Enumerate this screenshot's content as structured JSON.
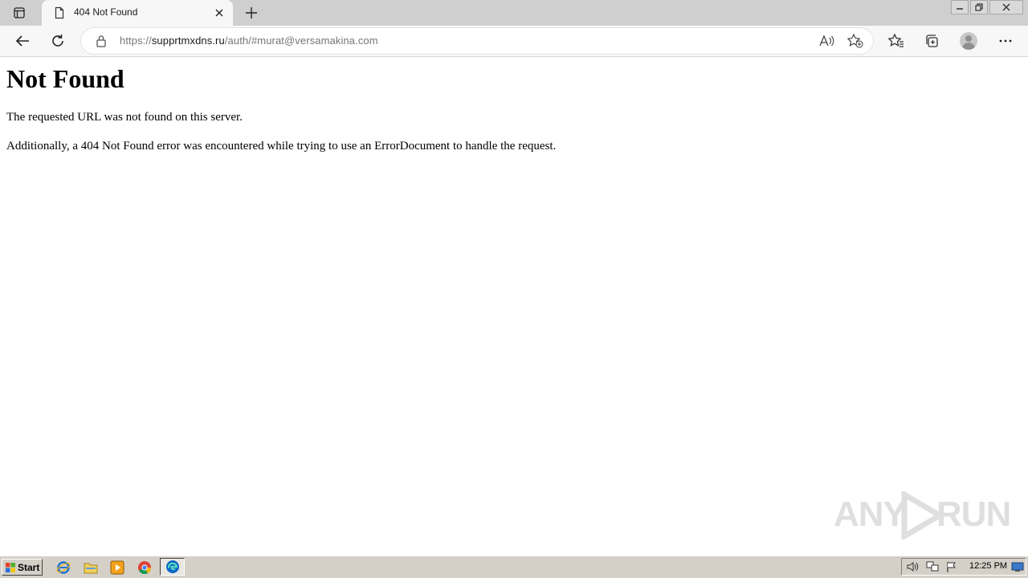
{
  "browser": {
    "tab": {
      "title": "404 Not Found"
    },
    "address": {
      "scheme": "https://",
      "host": "supprtmxdns.ru",
      "path": "/auth/#murat@versamakina.com"
    }
  },
  "page": {
    "heading": "Not Found",
    "paragraphs": [
      "The requested URL was not found on this server.",
      "Additionally, a 404 Not Found error was encountered while trying to use an ErrorDocument to handle the request."
    ]
  },
  "watermark": {
    "left": "ANY",
    "right": "RUN"
  },
  "taskbar": {
    "start_label": "Start",
    "clock": "12:25 PM"
  },
  "colors": {
    "accent_edge": "#0a66c8",
    "taskbar": "#d4d0c8"
  }
}
